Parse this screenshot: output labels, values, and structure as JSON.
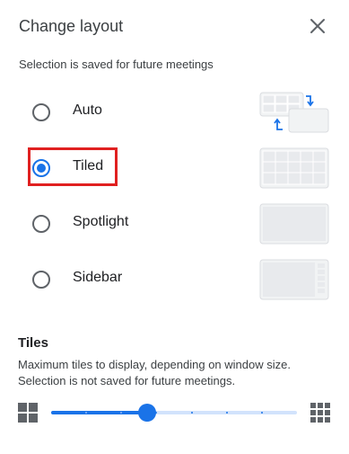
{
  "dialog": {
    "title": "Change layout",
    "subtitle": "Selection is saved for future meetings"
  },
  "options": [
    {
      "label": "Auto",
      "selected": false,
      "thumbnail": "auto-layout-icon"
    },
    {
      "label": "Tiled",
      "selected": true,
      "thumbnail": "tiled-layout-icon"
    },
    {
      "label": "Spotlight",
      "selected": false,
      "thumbnail": "spotlight-layout-icon"
    },
    {
      "label": "Sidebar",
      "selected": false,
      "thumbnail": "sidebar-layout-icon"
    }
  ],
  "tiles": {
    "heading": "Tiles",
    "description_line1": "Maximum tiles to display, depending on window size.",
    "description_line2": "Selection is not saved for future meetings.",
    "slider_fraction": 0.39,
    "slider_steps": 7
  },
  "colors": {
    "accent": "#1a73e8",
    "accent_light": "#d2e3fc",
    "highlight_box": "#e02020",
    "thumbnail_fill": "#e8eaed"
  }
}
